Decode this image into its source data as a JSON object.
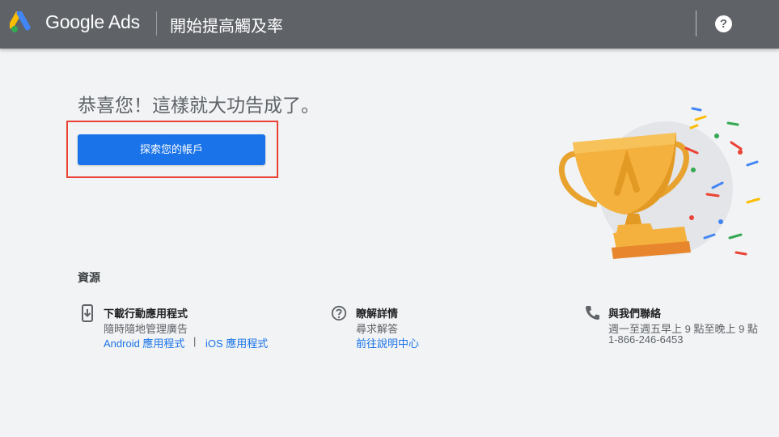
{
  "header": {
    "brand": "Google Ads",
    "page_title": "開始提高觸及率",
    "help_icon": "question-circle-icon"
  },
  "main": {
    "congrats_text": "恭喜您！這樣就大功告成了。",
    "explore_button_label": "探索您的帳戶",
    "illustration": "trophy-with-confetti"
  },
  "resources": {
    "title": "資源",
    "app": {
      "icon": "mobile-download-icon",
      "heading": "下載行動應用程式",
      "subtext": "隨時隨地管理廣告",
      "android_link": "Android 應用程式",
      "separator": "|",
      "ios_link": "iOS 應用程式"
    },
    "learn": {
      "icon": "help-circle-icon",
      "heading": "瞭解詳情",
      "subtext": "尋求解答",
      "link": "前往說明中心"
    },
    "contact": {
      "icon": "phone-icon",
      "heading": "與我們聯絡",
      "hours": "週一至週五早上 9 點至晚上 9 點",
      "phone": "1-866-246-6453"
    }
  },
  "colors": {
    "header_bg": "#5f6368",
    "page_bg": "#f1f3f4",
    "primary_blue": "#1a73e8",
    "highlight_red": "#ea4335",
    "trophy_gold": "#f4b13d"
  }
}
